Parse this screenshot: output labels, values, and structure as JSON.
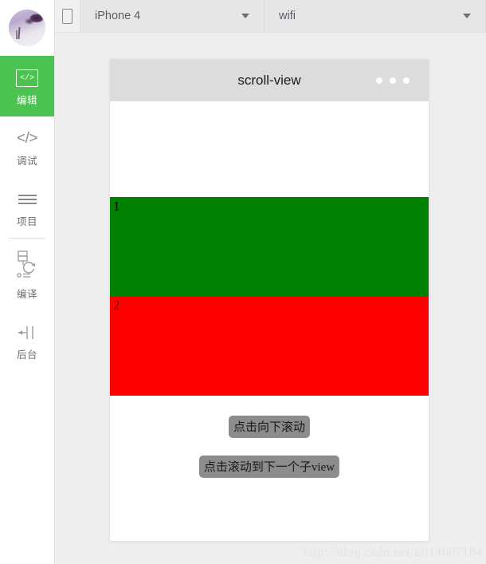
{
  "sidebar": {
    "avatar_name": "user-avatar",
    "items": [
      {
        "icon": "code-boxed-icon",
        "glyph": "</>",
        "label": "编辑",
        "active": true
      },
      {
        "icon": "code-icon",
        "glyph": "</>",
        "label": "调试",
        "active": false
      },
      {
        "icon": "list-icon",
        "glyph": "",
        "label": "项目",
        "active": false
      },
      {
        "icon": "compile-refresh-icon",
        "glyph": "",
        "label": "编译",
        "active": false
      },
      {
        "icon": "background-icon",
        "glyph": "",
        "label": "后台",
        "active": false
      }
    ]
  },
  "topbar": {
    "device_toggle_icon": "phone-frame-icon",
    "device_select": {
      "value": "iPhone 4",
      "caret": "chevron-down-icon"
    },
    "network_select": {
      "value": "wifi",
      "caret": "chevron-down-icon"
    }
  },
  "simulator": {
    "title": "scroll-view",
    "menu_dots": "more-options-icon",
    "blocks": [
      {
        "label": "1",
        "color": "#008000"
      },
      {
        "label": "2",
        "color": "#ff0000"
      }
    ],
    "buttons": [
      {
        "label": "点击向下滚动"
      },
      {
        "label": "点击滚动到下一个子view"
      }
    ]
  },
  "watermark": "http://blog.csdn.net/u014607184",
  "colors": {
    "accent_green": "#4CC250",
    "block_green": "#008000",
    "block_red": "#ff0000",
    "titlebar_gray": "#dcdcdc",
    "button_gray": "#8c8c8c"
  }
}
